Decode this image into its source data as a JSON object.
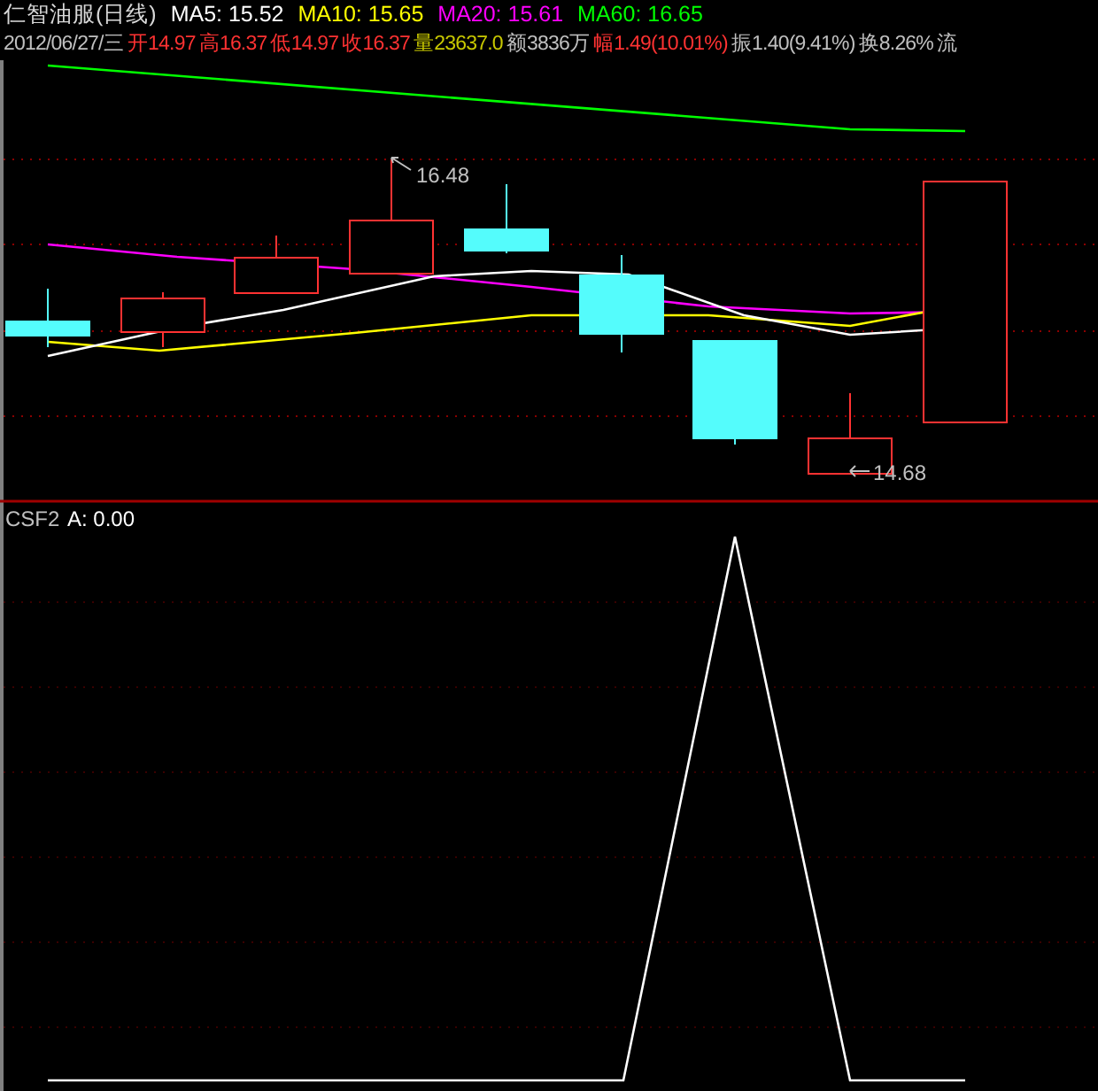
{
  "header": {
    "title": "仁智油服(日线)",
    "moving_averages": [
      {
        "label": "MA5:",
        "value": "15.52",
        "color": "#ffffff"
      },
      {
        "label": "MA10:",
        "value": "15.65",
        "color": "#ffff00"
      },
      {
        "label": "MA20:",
        "value": "15.61",
        "color": "#ff00ff"
      },
      {
        "label": "MA60:",
        "value": "16.65",
        "color": "#00ff00"
      }
    ],
    "date": "2012/06/27/三",
    "quote_items": [
      {
        "label": "开",
        "value": "14.97",
        "color": "#ff3232"
      },
      {
        "label": "高",
        "value": "16.37",
        "color": "#ff3232"
      },
      {
        "label": "低",
        "value": "14.97",
        "color": "#ff3232"
      },
      {
        "label": "收",
        "value": "16.37",
        "color": "#ff3232"
      },
      {
        "label": "量",
        "value": "23637.0",
        "color": "#c8c800"
      },
      {
        "label": "额",
        "value": "3836万",
        "color": "#c0c0c0"
      },
      {
        "label": "幅",
        "value": "1.49(10.01%)",
        "color": "#ff3232"
      },
      {
        "label": "振",
        "value": "1.40(9.41%)",
        "color": "#c0c0c0"
      },
      {
        "label": "换",
        "value": "8.26%",
        "color": "#c0c0c0"
      },
      {
        "label": "流",
        "color": "#c0c0c0"
      }
    ]
  },
  "price_chart": {
    "high_label": "16.48",
    "low_label": "14.68"
  },
  "indicator": {
    "name": "CSF2",
    "reading": "A: 0.00"
  }
}
